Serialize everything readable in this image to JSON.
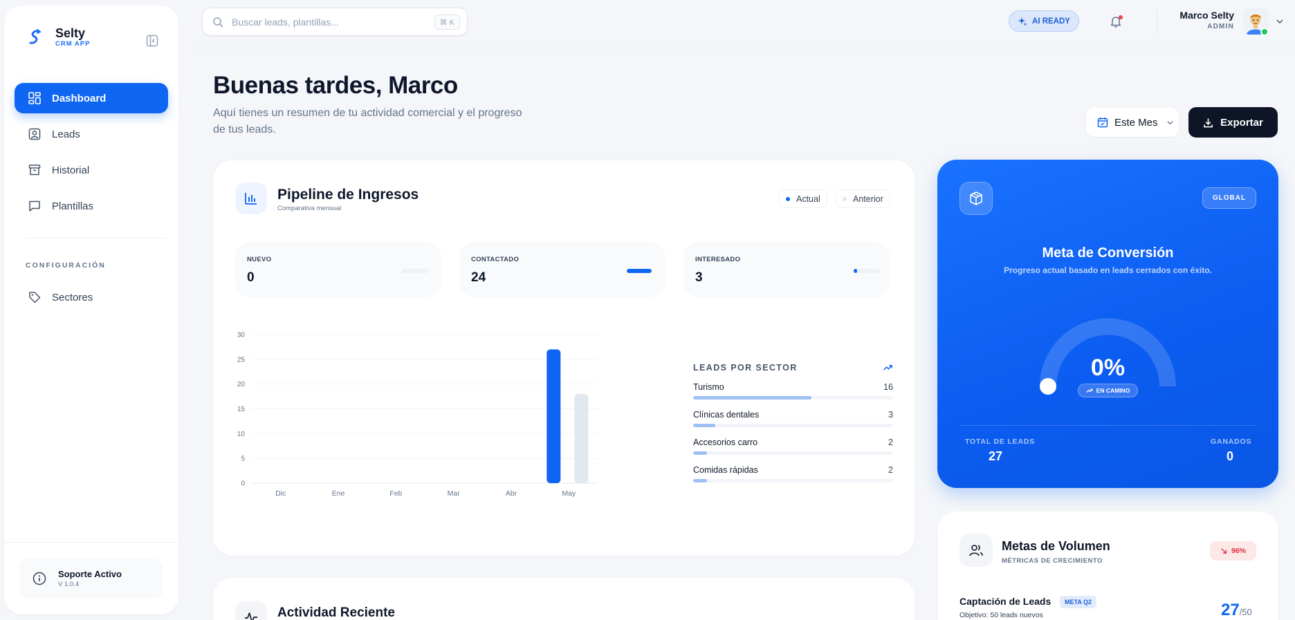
{
  "brand": {
    "name": "Selty",
    "subtitle": "CRM APP"
  },
  "sidebar": {
    "items": [
      {
        "label": "Dashboard",
        "icon": "dashboard-icon",
        "active": true
      },
      {
        "label": "Leads",
        "icon": "contact-icon"
      },
      {
        "label": "Historial",
        "icon": "archive-icon"
      },
      {
        "label": "Plantillas",
        "icon": "message-icon"
      }
    ],
    "section_label": "CONFIGURACIÓN",
    "config_items": [
      {
        "label": "Sectores",
        "icon": "tag-icon"
      }
    ],
    "support": {
      "title": "Soporte Activo",
      "version": "V 1.0.4"
    }
  },
  "topbar": {
    "search_placeholder": "Buscar leads, plantillas...",
    "shortcut": "⌘ K",
    "ai_badge": "AI READY",
    "user": {
      "name": "Marco Selty",
      "role": "ADMIN"
    }
  },
  "header": {
    "greeting": "Buenas tardes, Marco",
    "subtitle": "Aquí tienes un resumen de tu actividad comercial y el progreso de tus leads.",
    "period": "Este Mes",
    "export": "Exportar"
  },
  "pipeline": {
    "title": "Pipeline de Ingresos",
    "subtitle": "Comparativa mensual",
    "legend": [
      {
        "label": "Actual",
        "color": "#0f66f2"
      },
      {
        "label": "Anterior",
        "color": "#e2e8f0"
      }
    ],
    "stats": [
      {
        "label": "NUEVO",
        "value": "0",
        "fill": 0
      },
      {
        "label": "CONTACTADO",
        "value": "24",
        "fill": 1.0
      },
      {
        "label": "INTERESADO",
        "value": "3",
        "fill": 0.12
      }
    ]
  },
  "chart_data": {
    "type": "bar",
    "categories": [
      "Dic",
      "Ene",
      "Feb",
      "Mar",
      "Abr",
      "May"
    ],
    "series": [
      {
        "name": "Actual",
        "values": [
          0,
          0,
          0,
          0,
          0,
          27
        ],
        "color": "#0f66f2"
      },
      {
        "name": "Anterior",
        "values": [
          0,
          0,
          0,
          0,
          0,
          18
        ],
        "color": "#e2e8f0"
      }
    ],
    "yticks": [
      0,
      5,
      10,
      15,
      20,
      25,
      30
    ],
    "ylim": [
      0,
      30
    ],
    "grid": true
  },
  "sectors": {
    "title": "LEADS POR SECTOR",
    "items": [
      {
        "label": "Turismo",
        "count": "16",
        "fill": 0.59
      },
      {
        "label": "Clínicas dentales",
        "count": "3",
        "fill": 0.11
      },
      {
        "label": "Accesorios carro",
        "count": "2",
        "fill": 0.07
      },
      {
        "label": "Comidas rápidas",
        "count": "2",
        "fill": 0.07
      }
    ]
  },
  "activity": {
    "title": "Actividad Reciente"
  },
  "conversion": {
    "scope": "GLOBAL",
    "title": "Meta de Conversión",
    "subtitle": "Progreso actual basado en leads cerrados con éxito.",
    "value": "0%",
    "progress": 0,
    "status": "EN CAMINO",
    "total_label": "TOTAL DE LEADS",
    "total_value": "27",
    "won_label": "GANADOS",
    "won_value": "0"
  },
  "volume": {
    "title": "Metas de Volumen",
    "subtitle": "MÉTRICAS DE CRECIMIENTO",
    "trend": "96%",
    "item_title": "Captación de Leads",
    "item_badge": "META Q2",
    "item_sub": "Objetivo: 50 leads nuevos",
    "current": "27",
    "target": "/50"
  }
}
